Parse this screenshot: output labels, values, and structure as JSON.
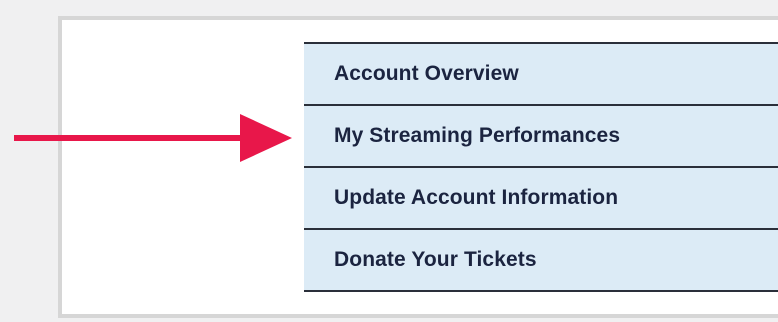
{
  "menu": {
    "items": [
      {
        "label": "Account Overview"
      },
      {
        "label": "My Streaming Performances"
      },
      {
        "label": "Update Account Information"
      },
      {
        "label": "Donate Your Tickets"
      }
    ]
  },
  "annotation": {
    "arrow_color": "#e8174a",
    "arrow_icon": "arrow-right-icon"
  },
  "colors": {
    "menu_background": "#dcebf6",
    "menu_text": "#1b2440",
    "divider": "#2a2f3a",
    "frame_border": "#d6d6d6"
  }
}
